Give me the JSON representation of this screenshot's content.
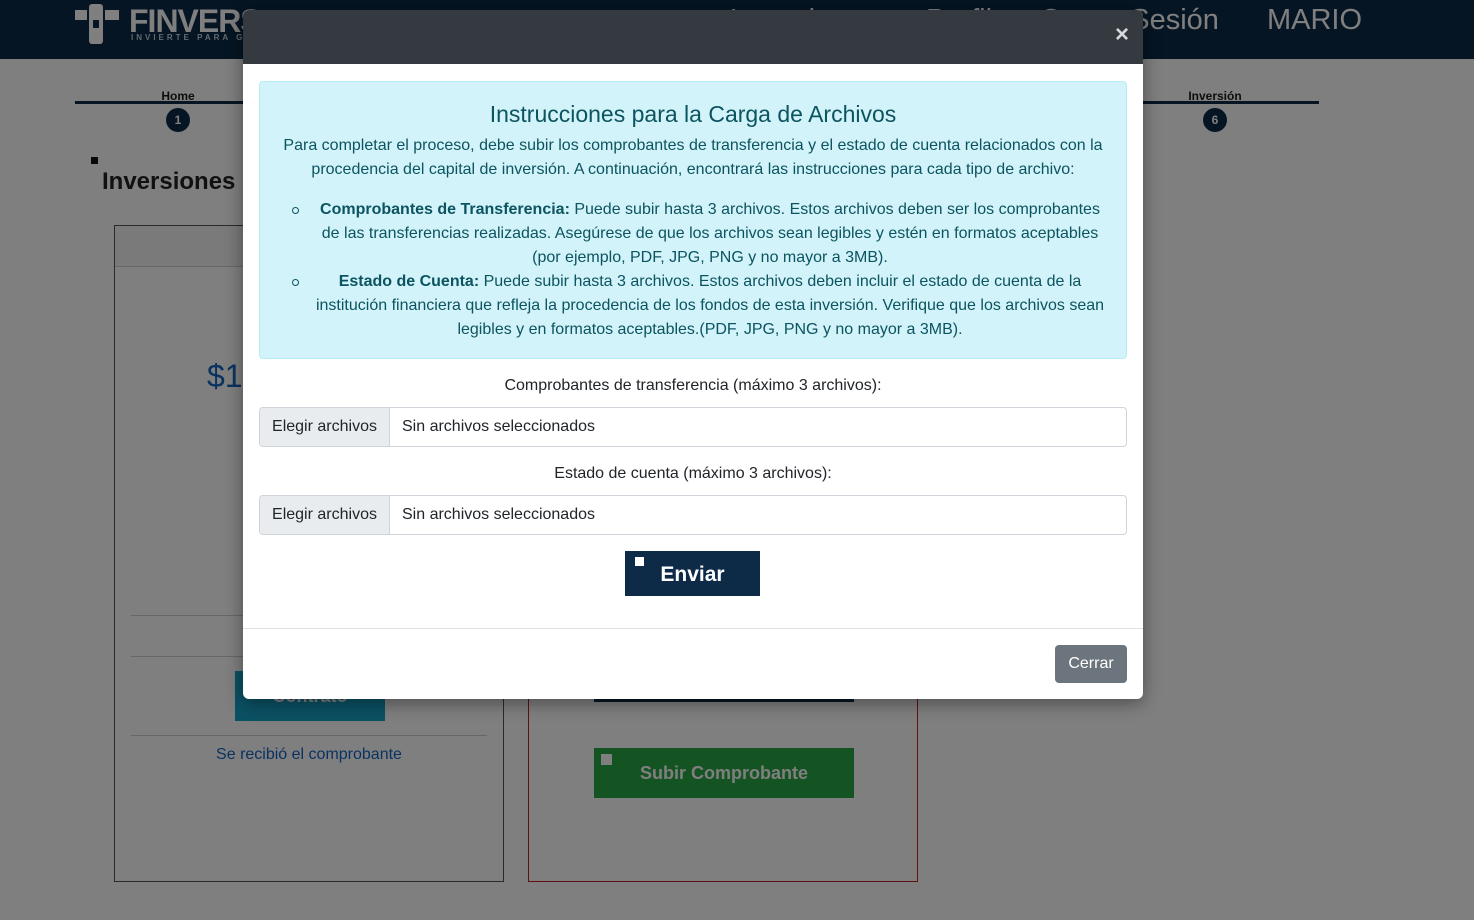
{
  "header": {
    "brand": "FINVERS",
    "tagline": "INVIERTE PARA GANAR",
    "nav": [
      "Inversiones",
      "Perfil",
      "Cerrar Sesión",
      "MARIO"
    ]
  },
  "steps": {
    "first": {
      "label": "Home",
      "number": "1"
    },
    "last": {
      "label": "Inversión",
      "number": "6"
    }
  },
  "page": {
    "title": "Inversiones",
    "amount_partial": "$1",
    "left_button": "Contrato",
    "received_text": "Se recibió el comprobante",
    "upload_button": "Subir Comprobante"
  },
  "modal": {
    "alert": {
      "title": "Instrucciones para la Carga de Archivos",
      "intro": "Para completar el proceso, debe subir los comprobantes de transferencia y el estado de cuenta relacionados con la procedencia del capital de inversión. A continuación, encontrará las instrucciones para cada tipo de archivo:",
      "items": [
        {
          "title": "Comprobantes de Transferencia:",
          "text": " Puede subir hasta 3 archivos. Estos archivos deben ser los comprobantes de las transferencias realizadas. Asegúrese de que los archivos sean legibles y estén en formatos aceptables (por ejemplo, PDF, JPG, PNG y no mayor a 3MB)."
        },
        {
          "title": "Estado de Cuenta:",
          "text": " Puede subir hasta 3 archivos. Estos archivos deben incluir el estado de cuenta de la institución financiera que refleja la procedencia de los fondos de esta inversión. Verifique que los archivos sean legibles y en formatos aceptables.(PDF, JPG, PNG y no mayor a 3MB)."
        }
      ]
    },
    "transfer_label": "Comprobantes de transferencia (máximo 3 archivos):",
    "statement_label": "Estado de cuenta (máximo 3 archivos):",
    "choose_files": "Elegir archivos",
    "no_files": "Sin archivos seleccionados",
    "send_button": "Enviar",
    "close_button": "Cerrar",
    "close_icon": "×"
  },
  "colors": {
    "navy": "#0d2a47",
    "alert_bg": "#d1f3f9",
    "alert_text": "#0c5460",
    "secondary": "#6c757d"
  }
}
